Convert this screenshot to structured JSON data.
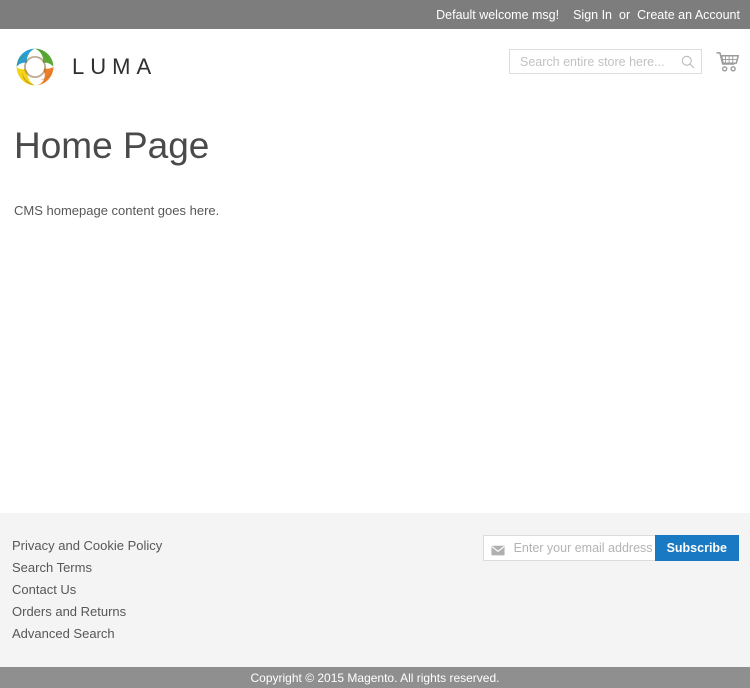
{
  "top_panel": {
    "welcome_message": "Default welcome msg!",
    "sign_in_label": "Sign In",
    "or_label": "or",
    "create_account_label": "Create an Account"
  },
  "header": {
    "logo_text": "LUMA",
    "logo_icon": "luma-pinwheel-logo",
    "search": {
      "placeholder": "Search entire store here...",
      "value": "",
      "icon": "search-icon"
    },
    "cart_icon": "shopping-cart-icon"
  },
  "main": {
    "page_title": "Home Page",
    "content_text": "CMS homepage content goes here."
  },
  "footer": {
    "links": [
      {
        "label": "Privacy and Cookie Policy"
      },
      {
        "label": "Search Terms"
      },
      {
        "label": "Contact Us"
      },
      {
        "label": "Orders and Returns"
      },
      {
        "label": "Advanced Search"
      }
    ],
    "newsletter": {
      "envelope_icon": "envelope-icon",
      "placeholder": "Enter your email address",
      "value": "",
      "subscribe_label": "Subscribe"
    }
  },
  "copyright": {
    "text": "Copyright © 2015 Magento. All rights reserved."
  },
  "colors": {
    "top_panel_bg": "#7d7d7d",
    "footer_bg": "#f4f4f4",
    "copyright_bg": "#8f8f8f",
    "accent_blue": "#1979c3",
    "logo_blue": "#2a9ed4",
    "logo_green": "#5aa932",
    "logo_orange": "#ef7d26",
    "logo_yellow": "#f5d417",
    "text_dark": "#333333",
    "text_muted": "#575757"
  }
}
